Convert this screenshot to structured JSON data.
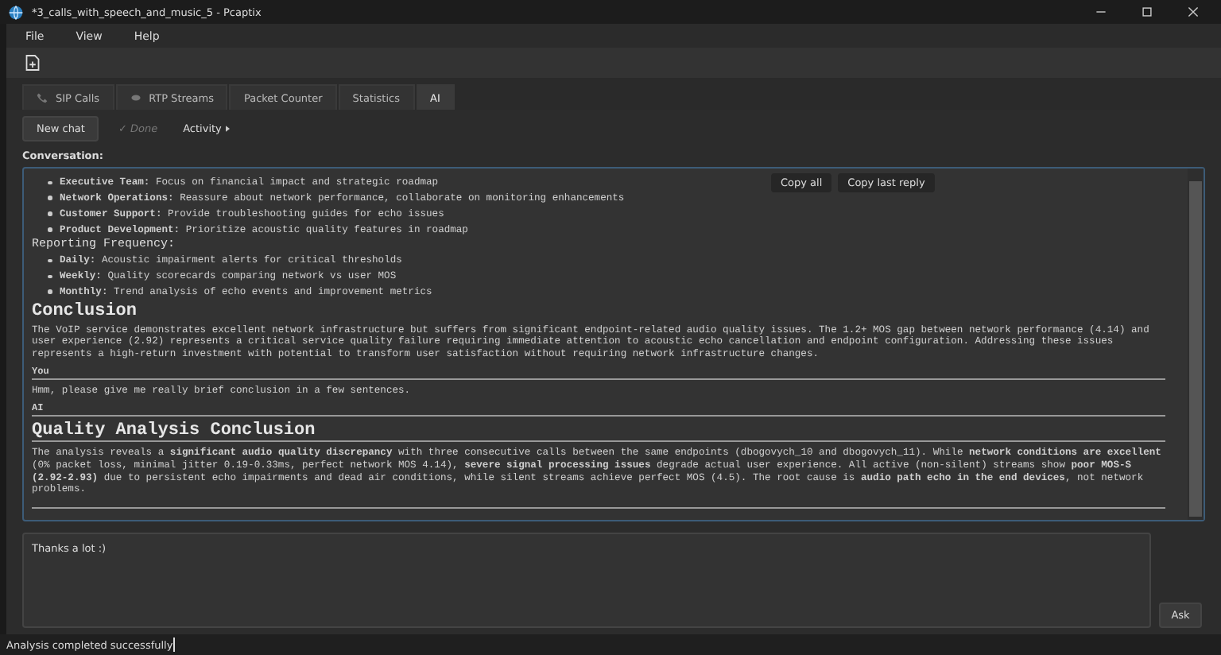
{
  "window": {
    "title": "*3_calls_with_speech_and_music_5 - Pcaptix"
  },
  "menu": [
    "File",
    "View",
    "Help"
  ],
  "tabs": [
    {
      "label": "SIP Calls",
      "selected": false
    },
    {
      "label": "RTP Streams",
      "selected": false
    },
    {
      "label": "Packet Counter",
      "selected": false
    },
    {
      "label": "Statistics",
      "selected": false
    },
    {
      "label": "AI",
      "selected": true
    }
  ],
  "actions": [
    {
      "label": "New chat",
      "kind": "button",
      "disabled": false
    },
    {
      "label": "✓ Done",
      "kind": "plain",
      "disabled": true
    },
    {
      "label": "Activity",
      "kind": "menu",
      "disabled": false
    }
  ],
  "conversation_label": "Conversation:",
  "copy_buttons": [
    "Copy all",
    "Copy last reply"
  ],
  "messages": [
    {
      "kind": "bullet",
      "text": "**Executive Team:** Focus on financial impact and strategic roadmap"
    },
    {
      "kind": "bullet",
      "text": "**Network Operations:** Reassure about network performance, collaborate on monitoring enhancements"
    },
    {
      "kind": "bullet",
      "text": "**Customer Support:** Provide troubleshooting guides for echo issues"
    },
    {
      "kind": "bullet",
      "text": "**Product Development:** Prioritize acoustic quality features in roadmap"
    },
    {
      "kind": "subheading",
      "text": "Reporting Frequency:"
    },
    {
      "kind": "bullet",
      "text": "**Daily:** Acoustic impairment alerts for critical thresholds"
    },
    {
      "kind": "bullet",
      "text": "**Weekly:** Quality scorecards comparing network vs user MOS"
    },
    {
      "kind": "bullet",
      "text": "**Monthly:** Trend analysis of echo events and improvement metrics"
    },
    {
      "kind": "heading",
      "text": "Conclusion"
    },
    {
      "kind": "paragraph",
      "text": "The VoIP service demonstrates excellent network infrastructure but suffers from significant endpoint-related audio quality issues. The 1.2+ MOS gap between network performance (4.14) and user experience (2.92) represents a critical service quality failure requiring immediate attention to acoustic echo cancellation and endpoint configuration. Addressing these issues represents a high-return investment with potential to transform user satisfaction without requiring network infrastructure changes."
    },
    {
      "kind": "speaker",
      "text": "You"
    },
    {
      "kind": "paragraph",
      "text": "Hmm, please give me really brief conclusion in a few sentences."
    },
    {
      "kind": "speaker",
      "text": "AI"
    },
    {
      "kind": "title",
      "text": "Quality Analysis Conclusion"
    },
    {
      "kind": "paragraph",
      "text": "The analysis reveals a **significant audio quality discrepancy** with three consecutive calls between the same endpoints (dbogovych_10 and dbogovych_11). While **network conditions are excellent** (0% packet loss, minimal jitter 0.19-0.33ms, perfect network MOS 4.14), **severe signal processing issues** degrade actual user experience. All active (non-silent) streams show **poor MOS-S (2.92-2.93)** due to persistent echo impairments and dead air conditions, while silent streams achieve perfect MOS (4.5). The root cause is **audio path echo in the end devices**, not network problems."
    },
    {
      "kind": "divider"
    }
  ],
  "input": {
    "value": "Thanks a lot :)"
  },
  "ask_button": "Ask",
  "status_bar": "Analysis completed successfully"
}
